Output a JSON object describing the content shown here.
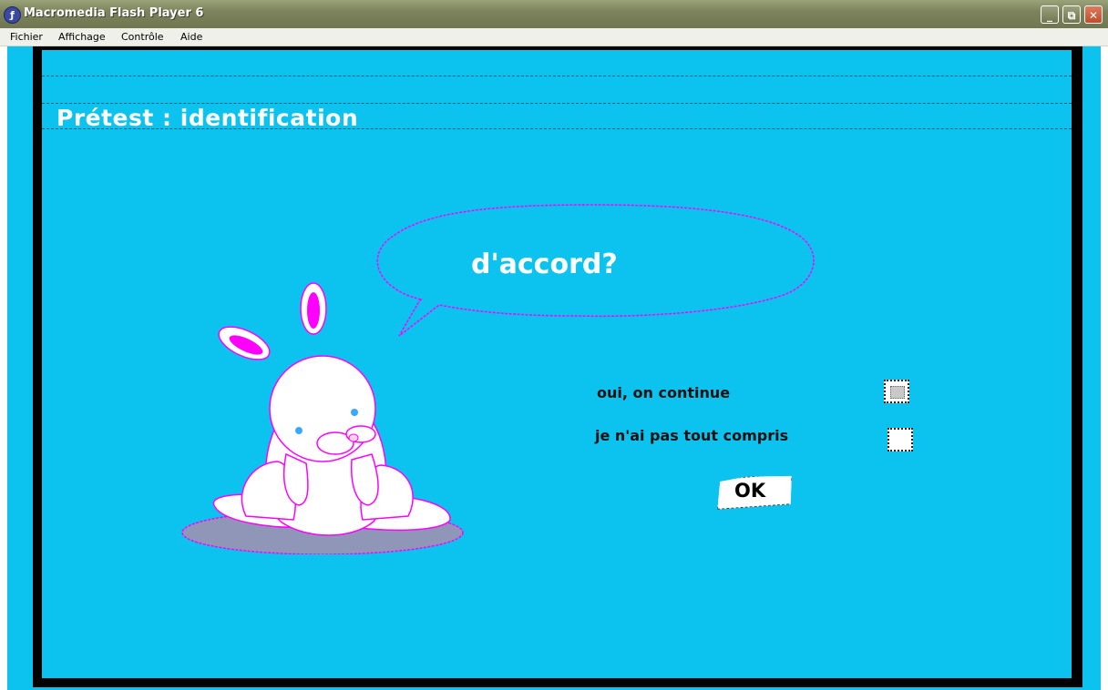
{
  "window": {
    "title": "Macromedia Flash Player 6",
    "icon": "flash-player-icon",
    "min_glyph": "_",
    "max_glyph": "⧉",
    "close_glyph": "✕"
  },
  "menu": {
    "items": [
      "Fichier",
      "Affichage",
      "Contrôle",
      "Aide"
    ]
  },
  "stage": {
    "background_color": "#0cc2ee",
    "title": "Prétest : identification",
    "bubble_text": "d'accord?",
    "options": [
      {
        "label": "oui, on continue",
        "checked": true
      },
      {
        "label": "je n'ai pas tout compris",
        "checked": false
      }
    ],
    "ok_label": "OK"
  },
  "colors": {
    "accent_magenta": "#ff00ff",
    "shadow": "#8f96b8",
    "rabbit_body": "#ffffff"
  }
}
